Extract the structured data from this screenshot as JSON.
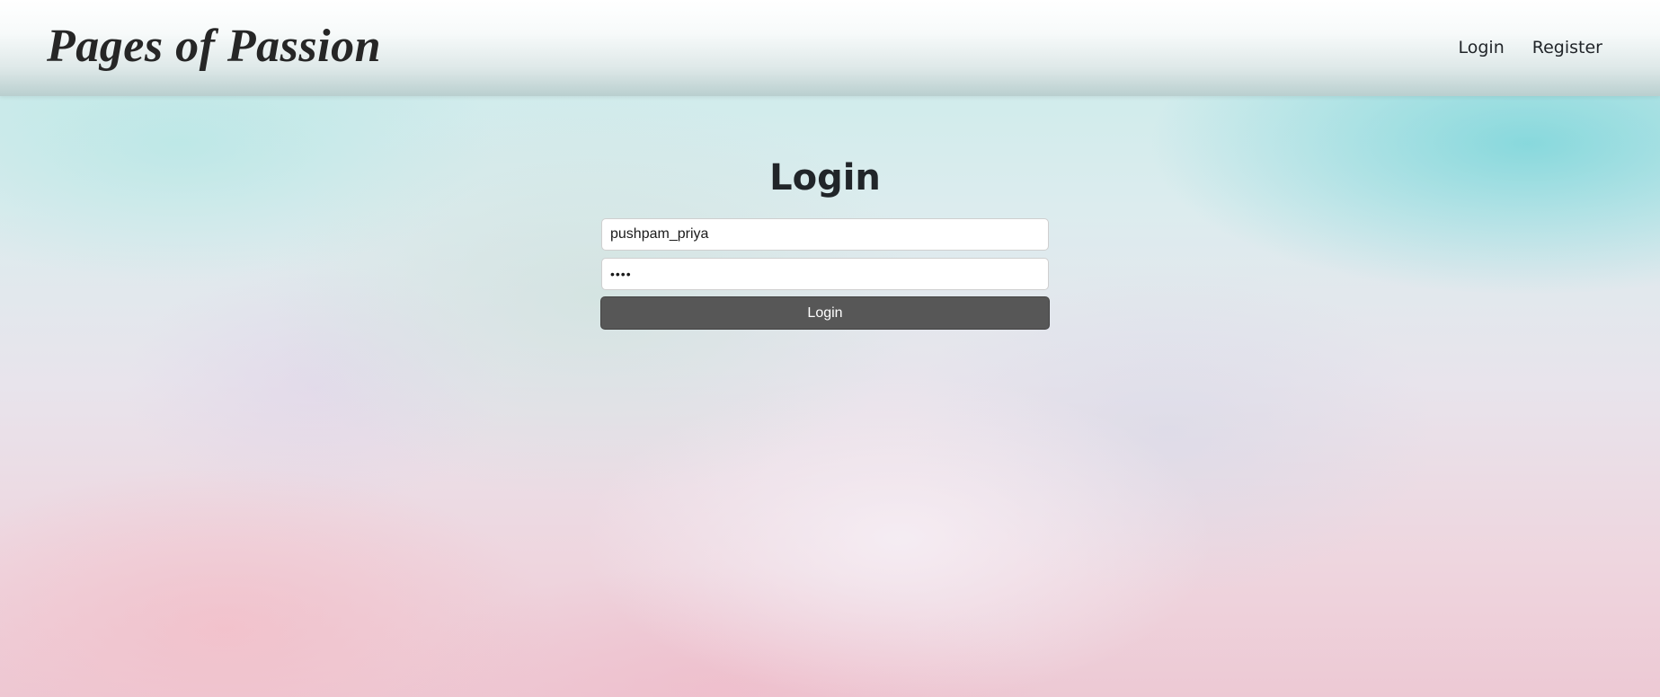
{
  "header": {
    "brand": "Pages of Passion",
    "nav": [
      {
        "label": "Login"
      },
      {
        "label": "Register"
      }
    ]
  },
  "login": {
    "title": "Login",
    "username_value": "pushpam_priya",
    "password_value": "••••",
    "submit_label": "Login"
  },
  "colors": {
    "button": "#575757",
    "text": "#212529"
  }
}
